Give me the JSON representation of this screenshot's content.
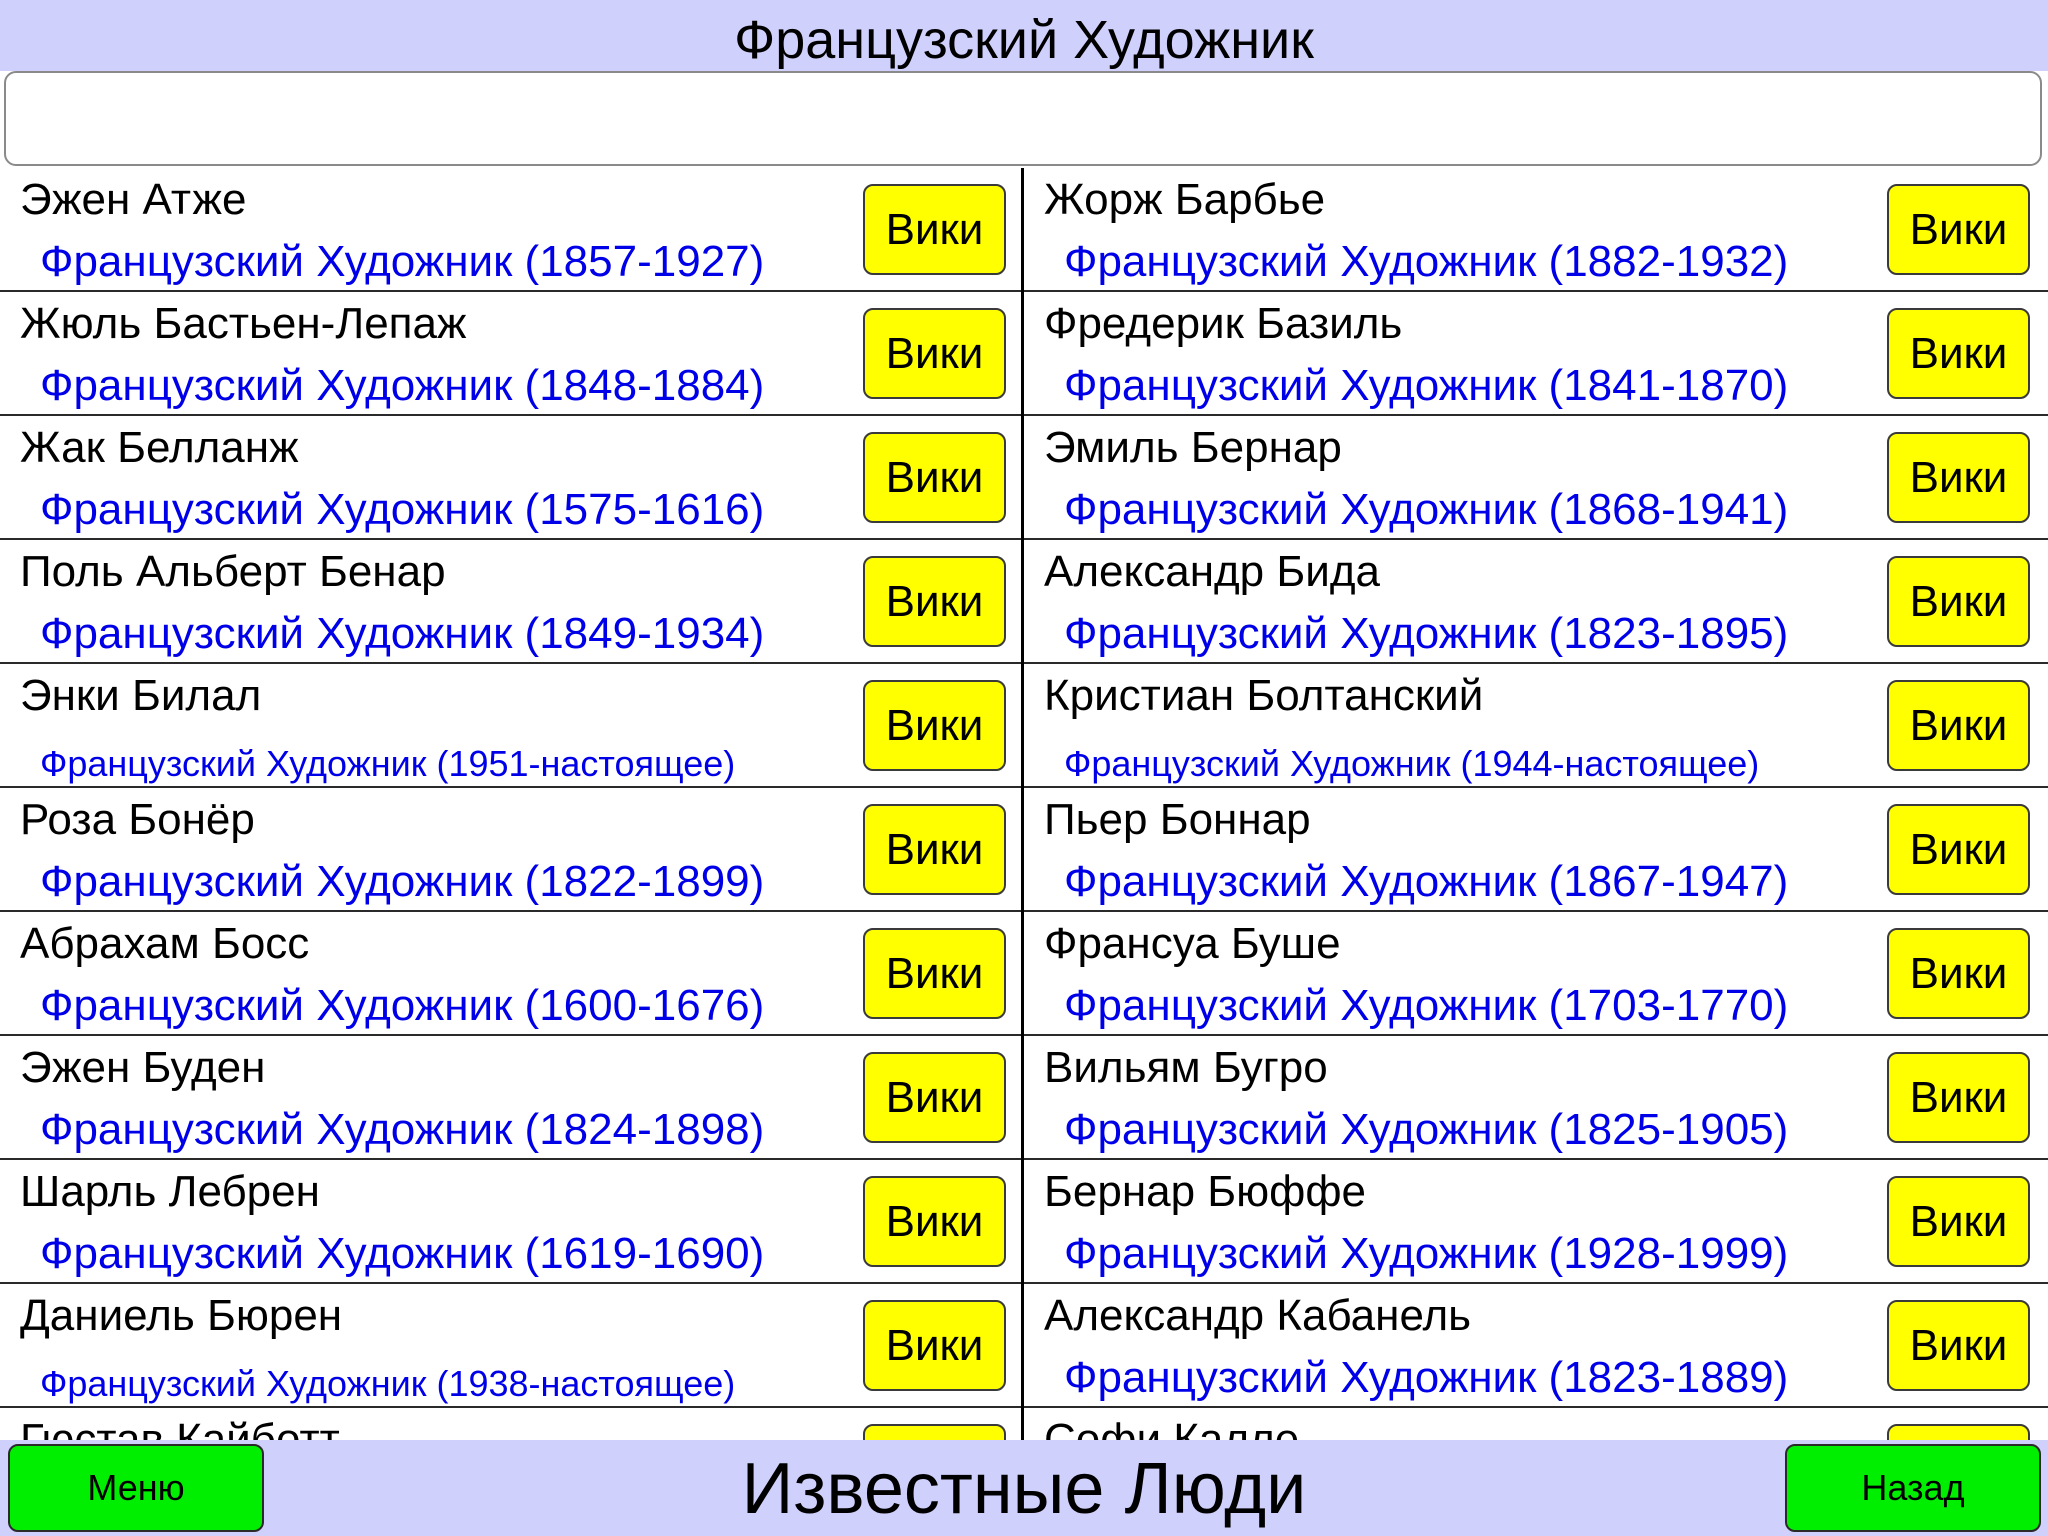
{
  "header": {
    "title": "Французский Художник"
  },
  "search": {
    "value": "",
    "placeholder": ""
  },
  "wiki_label": "Вики",
  "columns": {
    "left": [
      {
        "name": "Эжен Атже",
        "desc": "Французский Художник (1857-1927)"
      },
      {
        "name": "Жюль Бастьен-Лепаж",
        "desc": "Французский Художник (1848-1884)"
      },
      {
        "name": "Жак Белланж",
        "desc": "Французский Художник (1575-1616)"
      },
      {
        "name": "Поль Альберт Бенар",
        "desc": "Французский Художник (1849-1934)"
      },
      {
        "name": "Энки Билал",
        "desc": "Французский Художник (1951-настоящее)"
      },
      {
        "name": "Роза Бонёр",
        "desc": "Французский Художник (1822-1899)"
      },
      {
        "name": "Абрахам Босс",
        "desc": "Французский Художник (1600-1676)"
      },
      {
        "name": "Эжен Буден",
        "desc": "Французский Художник (1824-1898)"
      },
      {
        "name": "Шарль Лебрен",
        "desc": "Французский Художник (1619-1690)"
      },
      {
        "name": "Даниель Бюрен",
        "desc": "Французский Художник (1938-настоящее)"
      },
      {
        "name": "Гюстав Кайботт",
        "desc": ""
      }
    ],
    "right": [
      {
        "name": "Жорж Барбье",
        "desc": "Французский Художник (1882-1932)"
      },
      {
        "name": "Фредерик Базиль",
        "desc": "Французский Художник (1841-1870)"
      },
      {
        "name": "Эмиль Бернар",
        "desc": "Французский Художник (1868-1941)"
      },
      {
        "name": "Александр Бида",
        "desc": "Французский Художник (1823-1895)"
      },
      {
        "name": "Кристиан Болтанский",
        "desc": "Французский Художник (1944-настоящее)"
      },
      {
        "name": "Пьер Боннар",
        "desc": "Французский Художник (1867-1947)"
      },
      {
        "name": "Франсуа Буше",
        "desc": "Французский Художник (1703-1770)"
      },
      {
        "name": "Вильям Бугро",
        "desc": "Французский Художник (1825-1905)"
      },
      {
        "name": "Бернар Бюффе",
        "desc": "Французский Художник (1928-1999)"
      },
      {
        "name": "Александр Кабанель",
        "desc": "Французский Художник (1823-1889)"
      },
      {
        "name": "Софи Калле",
        "desc": ""
      }
    ]
  },
  "footer": {
    "menu_label": "Меню",
    "title": "Известные Люди",
    "back_label": "Назад"
  },
  "colors": {
    "bar_background": "#d0d0fc",
    "wiki_button": "#ffff00",
    "nav_button": "#00ef00",
    "desc_text": "#0000e8"
  }
}
